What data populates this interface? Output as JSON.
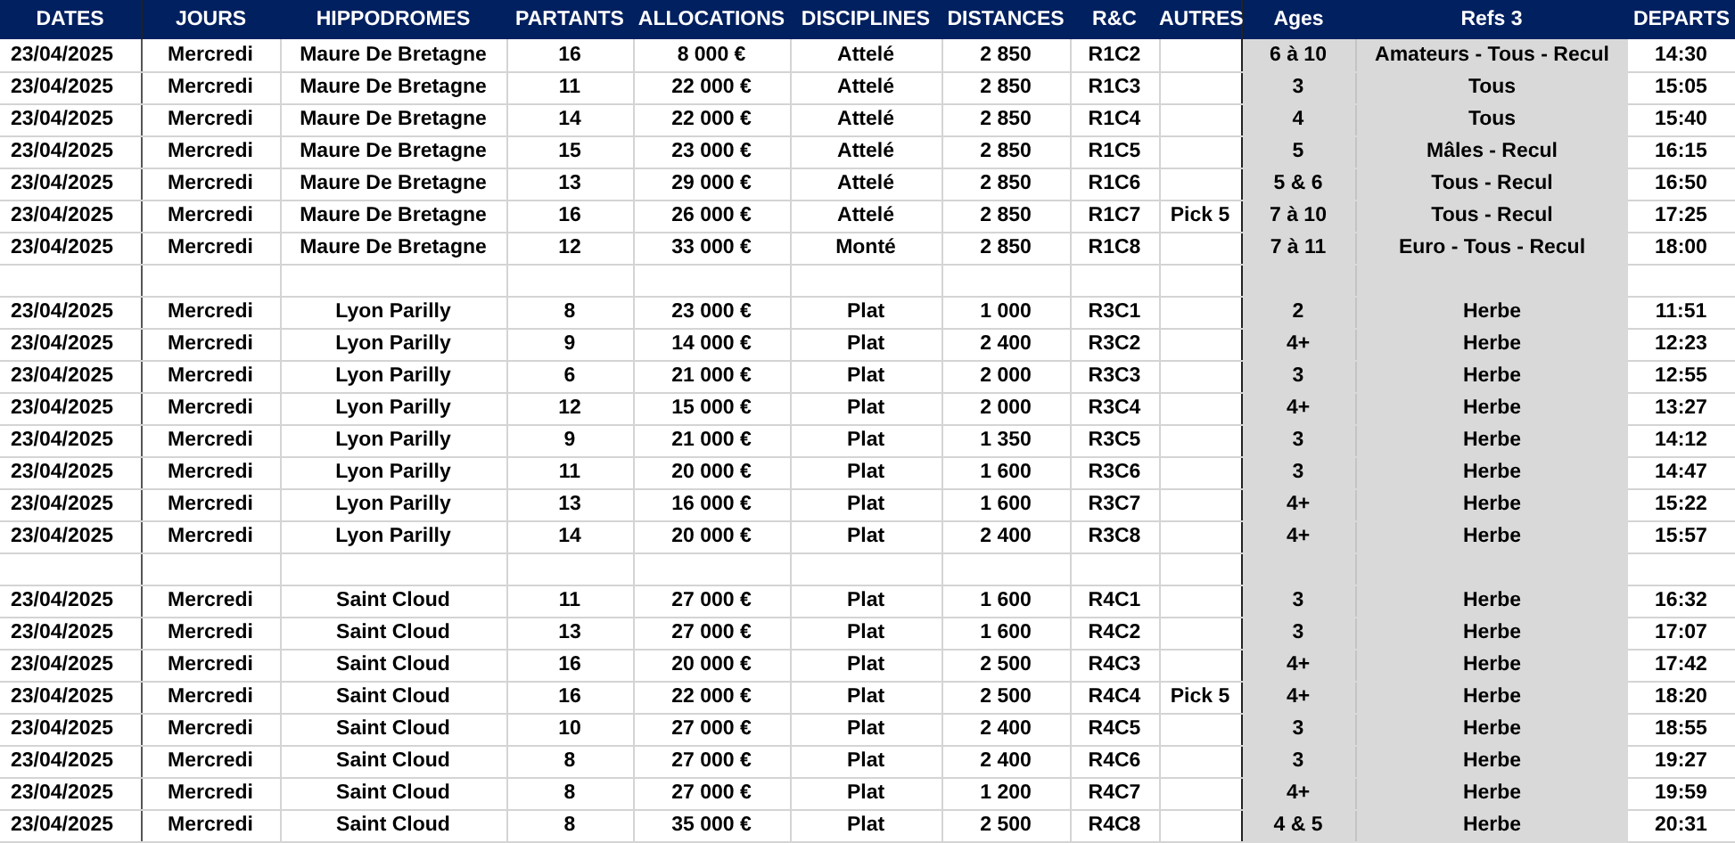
{
  "columns": [
    "DATES",
    "JOURS",
    "HIPPODROMES",
    "PARTANTS",
    "ALLOCATIONS",
    "DISCIPLINES",
    "DISTANCES",
    "R&C",
    "AUTRES",
    "Ages",
    "Refs 3",
    "DEPARTS"
  ],
  "sections": [
    {
      "rows": [
        [
          "23/04/2025",
          "Mercredi",
          "Maure De Bretagne",
          "16",
          "8 000 €",
          "Attelé",
          "2 850",
          "R1C2",
          "",
          "6 à 10",
          "Amateurs - Tous - Recul",
          "14:30"
        ],
        [
          "23/04/2025",
          "Mercredi",
          "Maure De Bretagne",
          "11",
          "22 000 €",
          "Attelé",
          "2 850",
          "R1C3",
          "",
          "3",
          "Tous",
          "15:05"
        ],
        [
          "23/04/2025",
          "Mercredi",
          "Maure De Bretagne",
          "14",
          "22 000 €",
          "Attelé",
          "2 850",
          "R1C4",
          "",
          "4",
          "Tous",
          "15:40"
        ],
        [
          "23/04/2025",
          "Mercredi",
          "Maure De Bretagne",
          "15",
          "23 000 €",
          "Attelé",
          "2 850",
          "R1C5",
          "",
          "5",
          "Mâles - Recul",
          "16:15"
        ],
        [
          "23/04/2025",
          "Mercredi",
          "Maure De Bretagne",
          "13",
          "29 000 €",
          "Attelé",
          "2 850",
          "R1C6",
          "",
          "5 & 6",
          "Tous - Recul",
          "16:50"
        ],
        [
          "23/04/2025",
          "Mercredi",
          "Maure De Bretagne",
          "16",
          "26 000 €",
          "Attelé",
          "2 850",
          "R1C7",
          "Pick 5",
          "7 à 10",
          "Tous - Recul",
          "17:25"
        ],
        [
          "23/04/2025",
          "Mercredi",
          "Maure De Bretagne",
          "12",
          "33 000 €",
          "Monté",
          "2 850",
          "R1C8",
          "",
          "7 à 11",
          "Euro - Tous - Recul",
          "18:00"
        ]
      ]
    },
    {
      "rows": [
        [
          "23/04/2025",
          "Mercredi",
          "Lyon Parilly",
          "8",
          "23 000 €",
          "Plat",
          "1 000",
          "R3C1",
          "",
          "2",
          "Herbe",
          "11:51"
        ],
        [
          "23/04/2025",
          "Mercredi",
          "Lyon Parilly",
          "9",
          "14 000 €",
          "Plat",
          "2 400",
          "R3C2",
          "",
          "4+",
          "Herbe",
          "12:23"
        ],
        [
          "23/04/2025",
          "Mercredi",
          "Lyon Parilly",
          "6",
          "21 000 €",
          "Plat",
          "2 000",
          "R3C3",
          "",
          "3",
          "Herbe",
          "12:55"
        ],
        [
          "23/04/2025",
          "Mercredi",
          "Lyon Parilly",
          "12",
          "15 000 €",
          "Plat",
          "2 000",
          "R3C4",
          "",
          "4+",
          "Herbe",
          "13:27"
        ],
        [
          "23/04/2025",
          "Mercredi",
          "Lyon Parilly",
          "9",
          "21 000 €",
          "Plat",
          "1 350",
          "R3C5",
          "",
          "3",
          "Herbe",
          "14:12"
        ],
        [
          "23/04/2025",
          "Mercredi",
          "Lyon Parilly",
          "11",
          "20 000 €",
          "Plat",
          "1 600",
          "R3C6",
          "",
          "3",
          "Herbe",
          "14:47"
        ],
        [
          "23/04/2025",
          "Mercredi",
          "Lyon Parilly",
          "13",
          "16 000 €",
          "Plat",
          "1 600",
          "R3C7",
          "",
          "4+",
          "Herbe",
          "15:22"
        ],
        [
          "23/04/2025",
          "Mercredi",
          "Lyon Parilly",
          "14",
          "20 000 €",
          "Plat",
          "2 400",
          "R3C8",
          "",
          "4+",
          "Herbe",
          "15:57"
        ]
      ]
    },
    {
      "rows": [
        [
          "23/04/2025",
          "Mercredi",
          "Saint Cloud",
          "11",
          "27 000 €",
          "Plat",
          "1 600",
          "R4C1",
          "",
          "3",
          "Herbe",
          "16:32"
        ],
        [
          "23/04/2025",
          "Mercredi",
          "Saint Cloud",
          "13",
          "27 000 €",
          "Plat",
          "1 600",
          "R4C2",
          "",
          "3",
          "Herbe",
          "17:07"
        ],
        [
          "23/04/2025",
          "Mercredi",
          "Saint Cloud",
          "16",
          "20 000 €",
          "Plat",
          "2 500",
          "R4C3",
          "",
          "4+",
          "Herbe",
          "17:42"
        ],
        [
          "23/04/2025",
          "Mercredi",
          "Saint Cloud",
          "16",
          "22 000 €",
          "Plat",
          "2 500",
          "R4C4",
          "Pick 5",
          "4+",
          "Herbe",
          "18:20"
        ],
        [
          "23/04/2025",
          "Mercredi",
          "Saint Cloud",
          "10",
          "27 000 €",
          "Plat",
          "2 400",
          "R4C5",
          "",
          "3",
          "Herbe",
          "18:55"
        ],
        [
          "23/04/2025",
          "Mercredi",
          "Saint Cloud",
          "8",
          "27 000 €",
          "Plat",
          "2 400",
          "R4C6",
          "",
          "3",
          "Herbe",
          "19:27"
        ],
        [
          "23/04/2025",
          "Mercredi",
          "Saint Cloud",
          "8",
          "27 000 €",
          "Plat",
          "1 200",
          "R4C7",
          "",
          "4+",
          "Herbe",
          "19:59"
        ],
        [
          "23/04/2025",
          "Mercredi",
          "Saint Cloud",
          "8",
          "35 000 €",
          "Plat",
          "2 500",
          "R4C8",
          "",
          "4 & 5",
          "Herbe",
          "20:31"
        ]
      ]
    }
  ]
}
